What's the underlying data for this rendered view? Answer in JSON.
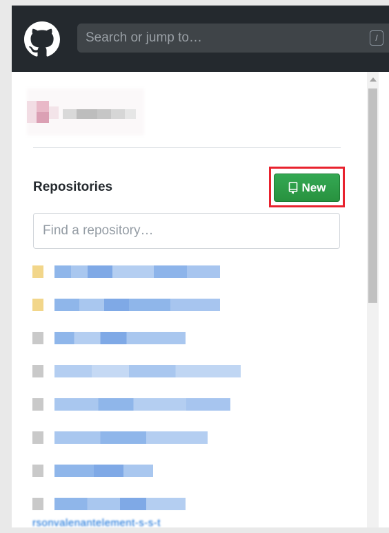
{
  "header": {
    "logo_icon": "github-octocat-icon",
    "search_placeholder": "Search or jump to…",
    "search_shortcut": "/"
  },
  "profile": {
    "avatar_icon": "avatar-icon",
    "username_visible": false
  },
  "repositories": {
    "title": "Repositories",
    "new_button_label": "New",
    "new_button_icon": "repo-book-icon",
    "find_placeholder": "Find a repository…",
    "items": [
      {
        "icon_color": "#f2d68a",
        "blurred": true
      },
      {
        "icon_color": "#f2d68a",
        "blurred": true
      },
      {
        "icon_color": "#c9c9c9",
        "blurred": true
      },
      {
        "icon_color": "#c9c9c9",
        "blurred": true
      },
      {
        "icon_color": "#c9c9c9",
        "blurred": true
      },
      {
        "icon_color": "#c9c9c9",
        "blurred": true
      },
      {
        "icon_color": "#c9c9c9",
        "blurred": true
      },
      {
        "icon_color": "#c9c9c9",
        "blurred": true
      }
    ],
    "last_item_partial_text": "rsonvalenantelement-s-s-t"
  },
  "colors": {
    "header_bg": "#24292e",
    "new_button_bg": "#2ea44f",
    "highlight_border": "#e8222e",
    "link_blue": "#0366d6"
  }
}
